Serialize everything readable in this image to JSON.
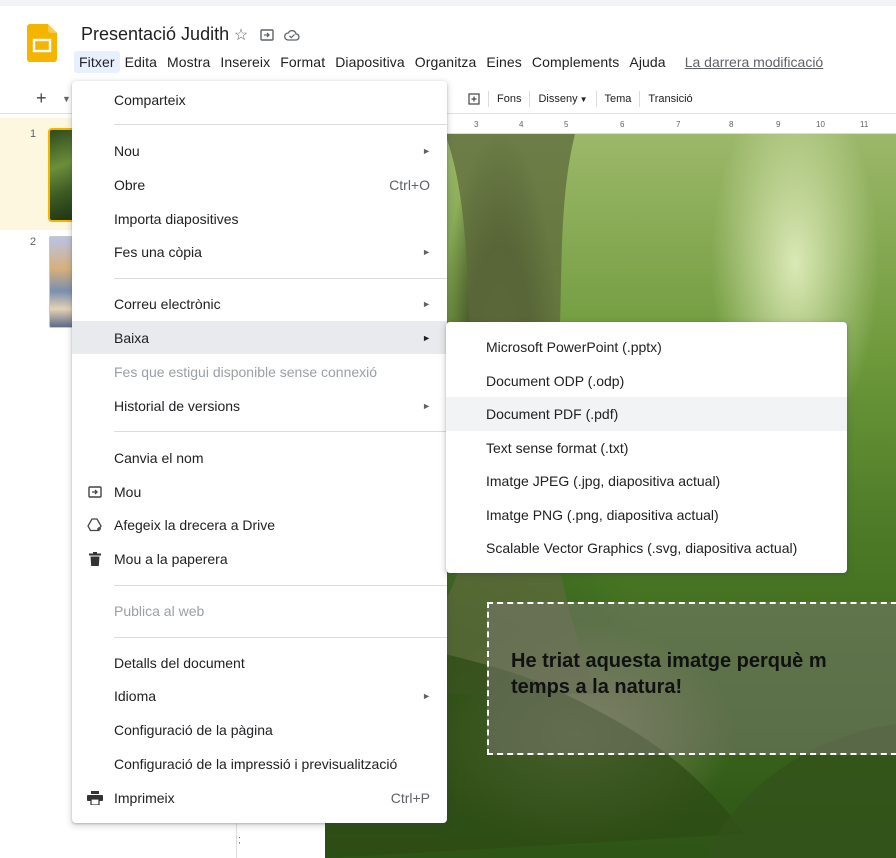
{
  "header": {
    "title": "Presentació Judith",
    "last_edit": "La darrera modificació",
    "menu": [
      "Fitxer",
      "Edita",
      "Mostra",
      "Insereix",
      "Format",
      "Diapositiva",
      "Organitza",
      "Eines",
      "Complements",
      "Ajuda"
    ]
  },
  "toolbar": {
    "add": "+",
    "buttons": [
      "Fons",
      "Disseny",
      "Tema",
      "Transició"
    ]
  },
  "ruler": [
    "3",
    "4",
    "5",
    "6",
    "7",
    "8",
    "9",
    "10",
    "11"
  ],
  "vruler": "14",
  "filmstrip": {
    "slides": [
      "1",
      "2"
    ]
  },
  "slide": {
    "text": "He triat aquesta imatge perquè m\ntemps a la natura!"
  },
  "file_menu": {
    "items": [
      {
        "label": "Comparteix"
      },
      {
        "label": "Nou"
      },
      {
        "label": "Obre",
        "shortcut": "Ctrl+O"
      },
      {
        "label": "Importa diapositives"
      },
      {
        "label": "Fes una còpia"
      },
      {
        "label": "Correu electrònic"
      },
      {
        "label": "Baixa"
      },
      {
        "label": "Fes que estigui disponible sense connexió"
      },
      {
        "label": "Historial de versions"
      },
      {
        "label": "Canvia el nom"
      },
      {
        "label": "Mou"
      },
      {
        "label": "Afegeix la drecera a Drive"
      },
      {
        "label": "Mou a la paperera"
      },
      {
        "label": "Publica al web"
      },
      {
        "label": "Detalls del document"
      },
      {
        "label": "Idioma"
      },
      {
        "label": "Configuració de la pàgina"
      },
      {
        "label": "Configuració de la impressió i previsualització"
      },
      {
        "label": "Imprimeix",
        "shortcut": "Ctrl+P"
      }
    ]
  },
  "download_menu": {
    "items": [
      "Microsoft PowerPoint (.pptx)",
      "Document ODP (.odp)",
      "Document PDF (.pdf)",
      "Text sense format (.txt)",
      "Imatge JPEG (.jpg, diapositiva actual)",
      "Imatge PNG (.png, diapositiva actual)",
      "Scalable Vector Graphics (.svg, diapositiva actual)"
    ]
  },
  "colors": {
    "slides_yellow": "#f4b400",
    "menu_hover": "#e8eaed",
    "active_menu": "#e8f0fe"
  },
  "icons": [
    "star-icon",
    "move-to-folder-icon",
    "cloud-status-icon",
    "folder-move-icon",
    "drive-shortcut-icon",
    "trash-icon",
    "print-icon"
  ]
}
